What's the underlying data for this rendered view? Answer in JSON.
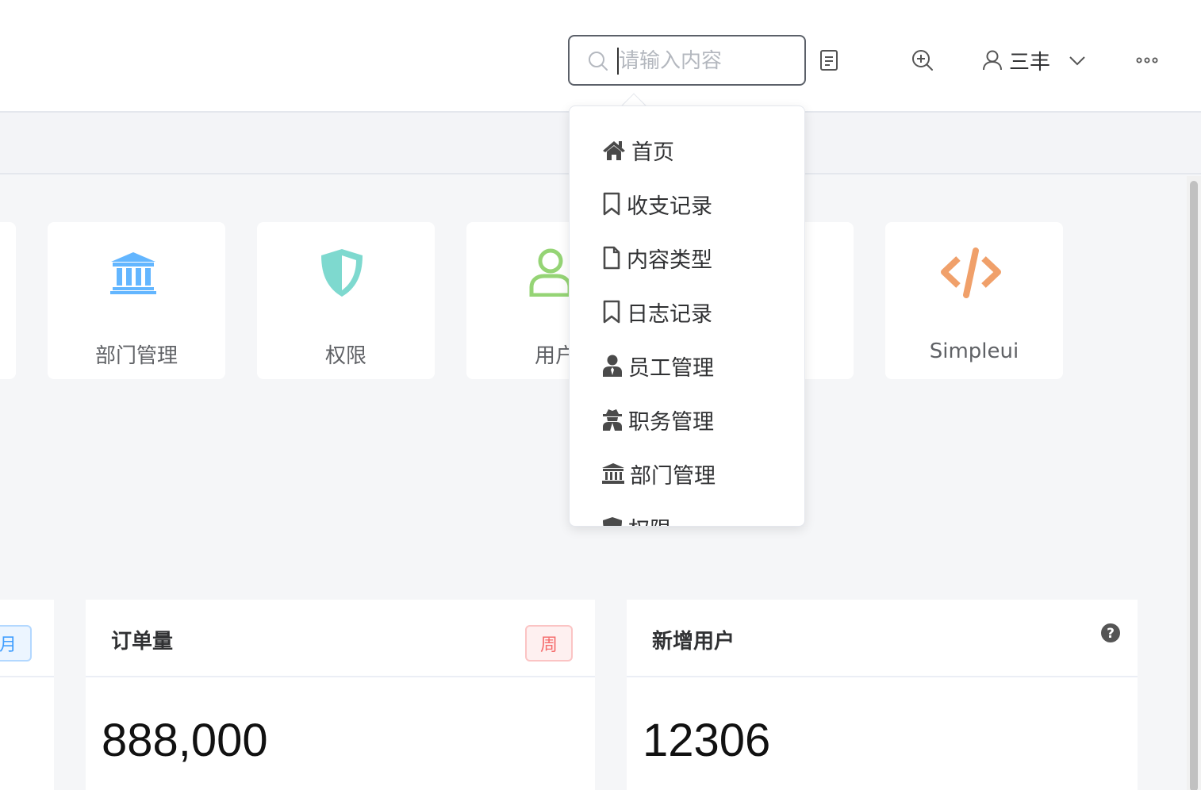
{
  "header": {
    "search_placeholder": "请输入内容",
    "user_name": "三丰",
    "icons": [
      "search-icon",
      "document-icon",
      "zoom-in-icon",
      "user-icon",
      "chevron-down-icon",
      "more-icon"
    ]
  },
  "dropdown": {
    "items": [
      {
        "label": "首页",
        "icon": "home-icon"
      },
      {
        "label": "收支记录",
        "icon": "bookmark-icon"
      },
      {
        "label": "内容类型",
        "icon": "file-icon"
      },
      {
        "label": "日志记录",
        "icon": "bookmark-icon"
      },
      {
        "label": "员工管理",
        "icon": "user-tie-icon"
      },
      {
        "label": "职务管理",
        "icon": "user-secret-icon"
      },
      {
        "label": "部门管理",
        "icon": "bank-icon"
      },
      {
        "label": "权限",
        "icon": "shield-icon"
      }
    ]
  },
  "shortcuts": [
    {
      "label": "部门管理",
      "icon": "bank-icon",
      "color": "#63b6ff"
    },
    {
      "label": "权限",
      "icon": "shield-icon",
      "color": "#7ed9cf"
    },
    {
      "label": "用户",
      "icon": "user-icon",
      "color": "#95d475"
    },
    {
      "label": "Simpleui",
      "icon": "code-icon",
      "color": "#f0a06a"
    }
  ],
  "stats": [
    {
      "title": "",
      "tag": "月",
      "value": ""
    },
    {
      "title": "订单量",
      "tag": "周",
      "value": "888,000"
    },
    {
      "title": "新增用户",
      "tag": "",
      "value": "12306"
    }
  ],
  "colors": {
    "month_tag": "#409eff",
    "week_tag": "#f56c6c",
    "help_icon": "#555555"
  }
}
